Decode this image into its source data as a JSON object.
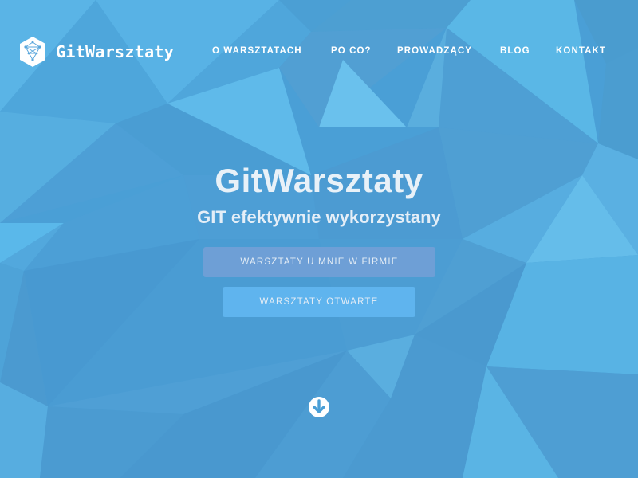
{
  "brand": {
    "name": "GitWarsztaty",
    "logo_icon": "hexagon-network-logo-icon"
  },
  "nav": {
    "items": [
      {
        "label": "O WARSZTATACH"
      },
      {
        "label": "PO CO?"
      },
      {
        "label": "PROWADZĄCY"
      },
      {
        "label": "BLOG"
      },
      {
        "label": "KONTAKT"
      }
    ]
  },
  "hero": {
    "title": "GitWarsztaty",
    "subtitle": "GIT efektywnie wykorzystany",
    "buttons": {
      "company": "WARSZTATY U MNIE W FIRMIE",
      "open": "WARSZTATY OTWARTE"
    },
    "scroll_icon": "arrow-down-icon"
  },
  "colors": {
    "background": "#4a9fd6",
    "button_company": "#6e9fd6",
    "button_open": "#5fb4ee",
    "text": "#ffffff"
  }
}
